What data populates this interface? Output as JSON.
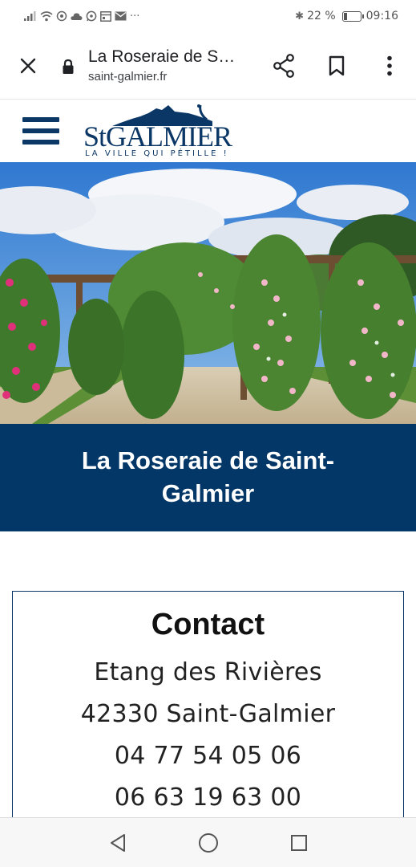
{
  "status_bar": {
    "left_icons": [
      "signal-icon",
      "wifi-icon",
      "gmail-icon",
      "cloud-icon",
      "whatsapp-icon",
      "calendar-icon",
      "mail-icon",
      "more-icon"
    ],
    "bluetooth": "✱",
    "battery_level": 0.22,
    "battery_text": "22 %",
    "time": "09:16"
  },
  "browser": {
    "page_title": "La Roseraie de S…",
    "domain": "saint-galmier.fr"
  },
  "site": {
    "logo_text": "StGALMIER",
    "logo_tagline": "LA VILLE QUI PÉTILLE !",
    "colors": {
      "brand": "#033768"
    }
  },
  "hero": {
    "title": "La Roseraie de Saint-Galmier"
  },
  "contact": {
    "heading": "Contact",
    "address_line1": "Etang des Rivières",
    "address_line2": "42330 Saint-Galmier",
    "phone1": "04 77 54 05 06",
    "phone2": "06 63 19 63 00"
  },
  "nav_bar": {
    "buttons": [
      "back-icon",
      "home-icon",
      "recents-icon"
    ]
  }
}
